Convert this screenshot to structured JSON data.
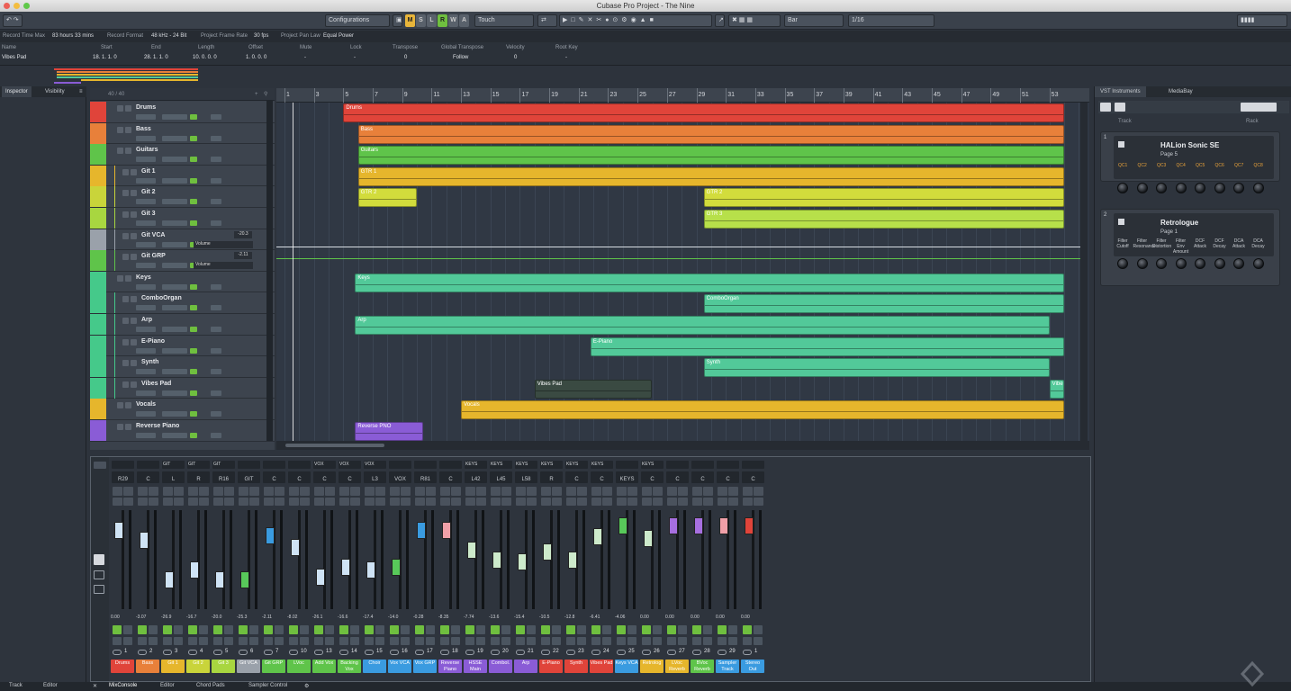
{
  "window": {
    "title": "Cubase Pro Project - The Nine"
  },
  "toolbar": {
    "configurations": "Configurations",
    "mode_buttons": [
      "M",
      "S",
      "L",
      "R",
      "W",
      "A"
    ],
    "automation_mode": "Touch",
    "grid_type": "Bar",
    "quantize": "1/16"
  },
  "info_line": [
    {
      "label": "Record Time Max",
      "value": "83 hours 33 mins"
    },
    {
      "label": "Record Format",
      "value": "48 kHz - 24 Bit"
    },
    {
      "label": "Project Frame Rate",
      "value": "30 fps"
    },
    {
      "label": "Project Pan Law",
      "value": "Equal Power"
    }
  ],
  "event_info": {
    "name_label": "Name",
    "name_value": "Vibes Pad",
    "fields": [
      {
        "label": "Start",
        "value": "18. 1. 1. 0"
      },
      {
        "label": "End",
        "value": "28. 1. 1. 0"
      },
      {
        "label": "Length",
        "value": "10. 0. 0. 0"
      },
      {
        "label": "Offset",
        "value": "1. 0. 0. 0"
      },
      {
        "label": "Mute",
        "value": "-"
      },
      {
        "label": "Lock",
        "value": "-"
      },
      {
        "label": "Transpose",
        "value": "0"
      },
      {
        "label": "Global Transpose",
        "value": "Follow"
      },
      {
        "label": "Velocity",
        "value": "0"
      },
      {
        "label": "Root Key",
        "value": "-"
      }
    ]
  },
  "left_zone": {
    "tabs": [
      "Inspector",
      "Visibility"
    ]
  },
  "track_list": {
    "count_label": "40 / 40",
    "tracks": [
      {
        "name": "Drums",
        "color": "#e0443a"
      },
      {
        "name": "Bass",
        "color": "#e8803a"
      },
      {
        "name": "Guitars",
        "color": "#5fc44a"
      },
      {
        "name": "Git 1",
        "color": "#e6b62c"
      },
      {
        "name": "Git 2",
        "color": "#c9d43a"
      },
      {
        "name": "Git 3",
        "color": "#a8d640"
      },
      {
        "name": "Git VCA",
        "color": "#9aa1aa",
        "value": "-20.3",
        "automation": "Volume"
      },
      {
        "name": "Git GRP",
        "color": "#5fc44a",
        "value": "-2.11",
        "automation": "Volume"
      },
      {
        "name": "Keys",
        "color": "#45c98a"
      },
      {
        "name": "ComboOrgan",
        "color": "#45c98a"
      },
      {
        "name": "Arp",
        "color": "#45c98a"
      },
      {
        "name": "E-Piano",
        "color": "#45c98a"
      },
      {
        "name": "Synth",
        "color": "#45c98a"
      },
      {
        "name": "Vibes Pad",
        "color": "#45c98a"
      },
      {
        "name": "Vocals",
        "color": "#e6b62c"
      },
      {
        "name": "Reverse Piano",
        "color": "#8a5cd6"
      }
    ]
  },
  "ruler": {
    "bars": [
      "1",
      "3",
      "5",
      "7",
      "9",
      "11",
      "13",
      "15",
      "17",
      "19",
      "21",
      "23",
      "25",
      "27",
      "29",
      "31",
      "33",
      "35",
      "37",
      "39",
      "41",
      "43",
      "45",
      "47",
      "49",
      "51",
      "53"
    ]
  },
  "parts": [
    {
      "name": "Drums",
      "color": "#e0443a",
      "row": 0,
      "start": 5,
      "end": 54
    },
    {
      "name": "Bass",
      "color": "#e8803a",
      "row": 1,
      "start": 6,
      "end": 54
    },
    {
      "name": "Guitars",
      "color": "#5fc44a",
      "row": 2,
      "start": 6,
      "end": 54
    },
    {
      "name": "GTR 1",
      "color": "#e6b62c",
      "row": 3,
      "start": 6,
      "end": 54
    },
    {
      "name": "GTR 2",
      "color": "#d2dc3c",
      "row": 4,
      "start": 6,
      "end": 10
    },
    {
      "name": "GTR 2",
      "color": "#d2dc3c",
      "row": 4,
      "start": 29.5,
      "end": 54
    },
    {
      "name": "GTR 3",
      "color": "#b7e04a",
      "row": 5,
      "start": 29.5,
      "end": 54
    },
    {
      "name": "Keys",
      "color": "#52c999",
      "row": 8,
      "start": 5.8,
      "end": 54
    },
    {
      "name": "ComboOrgan",
      "color": "#52c999",
      "row": 9,
      "start": 29.5,
      "end": 54
    },
    {
      "name": "Arp",
      "color": "#52c999",
      "row": 10,
      "start": 5.8,
      "end": 53
    },
    {
      "name": "E-Piano",
      "color": "#52c999",
      "row": 11,
      "start": 21.8,
      "end": 54
    },
    {
      "name": "Synth",
      "color": "#52c999",
      "row": 12,
      "start": 29.5,
      "end": 53
    },
    {
      "name": "Vibes Pad",
      "color": "#3a4a42",
      "row": 13,
      "start": 18,
      "end": 26
    },
    {
      "name": "Vibes",
      "color": "#52c999",
      "row": 13,
      "start": 53,
      "end": 54
    },
    {
      "name": "Vocals",
      "color": "#e6b62c",
      "row": 14,
      "start": 13,
      "end": 54
    },
    {
      "name": "Reverse PNO",
      "color": "#8a5cd6",
      "row": 15,
      "start": 5.8,
      "end": 10.4
    }
  ],
  "right_zone": {
    "tabs": [
      "VST Instruments",
      "MediaBay"
    ],
    "header_track": "Track",
    "header_rack": "Rack",
    "instruments": [
      {
        "slot": "1",
        "name": "HALion Sonic SE",
        "page": "Page 5",
        "params": [
          "QC1",
          "QC2",
          "QC3",
          "QC4",
          "QC5",
          "QC6",
          "QC7",
          "QC8"
        ]
      },
      {
        "slot": "2",
        "name": "Retrologue",
        "page": "Page 1",
        "params": [
          "Filter Cutoff",
          "Filter Resonance",
          "Filter Distortion",
          "Filter Env Amount",
          "DCF Attack",
          "DCF Decay",
          "DCA Attack",
          "DCA Decay"
        ]
      }
    ]
  },
  "mixer": {
    "channels": [
      {
        "badge": "",
        "pan": "R29",
        "value": "0.00",
        "num": "1",
        "label": "Drums",
        "color": "#e0443a",
        "cap": "#cfe3f5",
        "pos": 0.2
      },
      {
        "badge": "",
        "pan": "C",
        "value": "-3.07",
        "num": "2",
        "label": "Bass",
        "color": "#e8803a",
        "cap": "#cfe3f5",
        "pos": 0.3
      },
      {
        "badge": "GIT",
        "pan": "L",
        "value": "-26.9",
        "num": "3",
        "label": "Git 1",
        "color": "#e6b62c",
        "cap": "#cfe3f5",
        "pos": 0.7
      },
      {
        "badge": "GIT",
        "pan": "R",
        "value": "-16.7",
        "num": "4",
        "label": "Git 2",
        "color": "#c9d43a",
        "cap": "#cfe3f5",
        "pos": 0.6
      },
      {
        "badge": "GIT",
        "pan": "R16",
        "value": "-20.0",
        "num": "5",
        "label": "Git 3",
        "color": "#a8d640",
        "cap": "#cfe3f5",
        "pos": 0.7
      },
      {
        "badge": "",
        "pan": "GIT",
        "value": "-25.3",
        "num": "6",
        "label": "Git VCA",
        "color": "#9aa1aa",
        "cap": "#58c95a",
        "pos": 0.7
      },
      {
        "badge": "",
        "pan": "C",
        "value": "-2.11",
        "num": "7",
        "label": "Git GRP",
        "color": "#5fc44a",
        "cap": "#3a9be0",
        "pos": 0.25
      },
      {
        "badge": "",
        "pan": "C",
        "value": "-8.02",
        "num": "10",
        "label": "LVoc",
        "color": "#5fc44a",
        "cap": "#cfe3f5",
        "pos": 0.37
      },
      {
        "badge": "VOX",
        "pan": "C",
        "value": "-26.1",
        "num": "13",
        "label": "Add Vox",
        "color": "#5fc44a",
        "cap": "#cfe3f5",
        "pos": 0.67
      },
      {
        "badge": "VOX",
        "pan": "C",
        "value": "-16.6",
        "num": "14",
        "label": "Backing Vox",
        "color": "#5fc44a",
        "cap": "#cfe3f5",
        "pos": 0.57
      },
      {
        "badge": "VOX",
        "pan": "L3",
        "value": "-17.4",
        "num": "15",
        "label": "Choir",
        "color": "#3a9be0",
        "cap": "#cfe3f5",
        "pos": 0.6
      },
      {
        "badge": "",
        "pan": "VOX",
        "value": "-14.0",
        "num": "16",
        "label": "Vox VCA",
        "color": "#3a9be0",
        "cap": "#58c95a",
        "pos": 0.57
      },
      {
        "badge": "",
        "pan": "R81",
        "value": "-0.28",
        "num": "17",
        "label": "Vox GRP",
        "color": "#3a9be0",
        "cap": "#3a9be0",
        "pos": 0.2
      },
      {
        "badge": "",
        "pan": "C",
        "value": "-8.35",
        "num": "18",
        "label": "Reverse Piano",
        "color": "#8a5cd6",
        "cap": "#f0a0a8",
        "pos": 0.2
      },
      {
        "badge": "KEYS",
        "pan": "L42",
        "value": "-7.74",
        "num": "19",
        "label": "HSSE Main",
        "color": "#8a5cd6",
        "cap": "#cdeacb",
        "pos": 0.4
      },
      {
        "badge": "KEYS",
        "pan": "L45",
        "value": "-13.6",
        "num": "20",
        "label": "Combol.",
        "color": "#8a5cd6",
        "cap": "#cdeacb",
        "pos": 0.5
      },
      {
        "badge": "KEYS",
        "pan": "L58",
        "value": "-15.4",
        "num": "21",
        "label": "Arp",
        "color": "#8a5cd6",
        "cap": "#cdeacb",
        "pos": 0.52
      },
      {
        "badge": "KEYS",
        "pan": "R",
        "value": "-10.5",
        "num": "22",
        "label": "E-Piano",
        "color": "#e0443a",
        "cap": "#cdeacb",
        "pos": 0.42
      },
      {
        "badge": "KEYS",
        "pan": "C",
        "value": "-12.8",
        "num": "23",
        "label": "Synth",
        "color": "#e0443a",
        "cap": "#cdeacb",
        "pos": 0.5
      },
      {
        "badge": "KEYS",
        "pan": "C",
        "value": "-6.41",
        "num": "24",
        "label": "Vibes Pad",
        "color": "#e0443a",
        "cap": "#cdeacb",
        "pos": 0.26
      },
      {
        "badge": "",
        "pan": "KEYS",
        "value": "-4.06",
        "num": "25",
        "label": "Keys VCA",
        "color": "#3a9be0",
        "cap": "#58c95a",
        "pos": 0.15
      },
      {
        "badge": "KEYS",
        "pan": "C",
        "value": "0.00",
        "num": "26",
        "label": "Retrolog",
        "color": "#e6b62c",
        "cap": "#cdeacb",
        "pos": 0.28
      },
      {
        "badge": "",
        "pan": "C",
        "value": "0.00",
        "num": "27",
        "label": "LVoc Reverb",
        "color": "#e6b62c",
        "cap": "#a66fe0",
        "pos": 0.15
      },
      {
        "badge": "",
        "pan": "C",
        "value": "0.00",
        "num": "28",
        "label": "BVoc Reverb",
        "color": "#5fc44a",
        "cap": "#a66fe0",
        "pos": 0.15
      },
      {
        "badge": "",
        "pan": "C",
        "value": "0.00",
        "num": "29",
        "label": "Sampler Track",
        "color": "#3a9be0",
        "cap": "#f0a0a8",
        "pos": 0.15
      },
      {
        "badge": "",
        "pan": "C",
        "value": "0.00",
        "num": "1",
        "label": "Stereo Out",
        "color": "#3a9be0",
        "cap": "#e0443a",
        "pos": 0.15
      }
    ]
  },
  "bottom_tabs": [
    "Track",
    "Editor",
    "MixConsole",
    "Editor",
    "Chord Pads",
    "Sampler Control"
  ]
}
